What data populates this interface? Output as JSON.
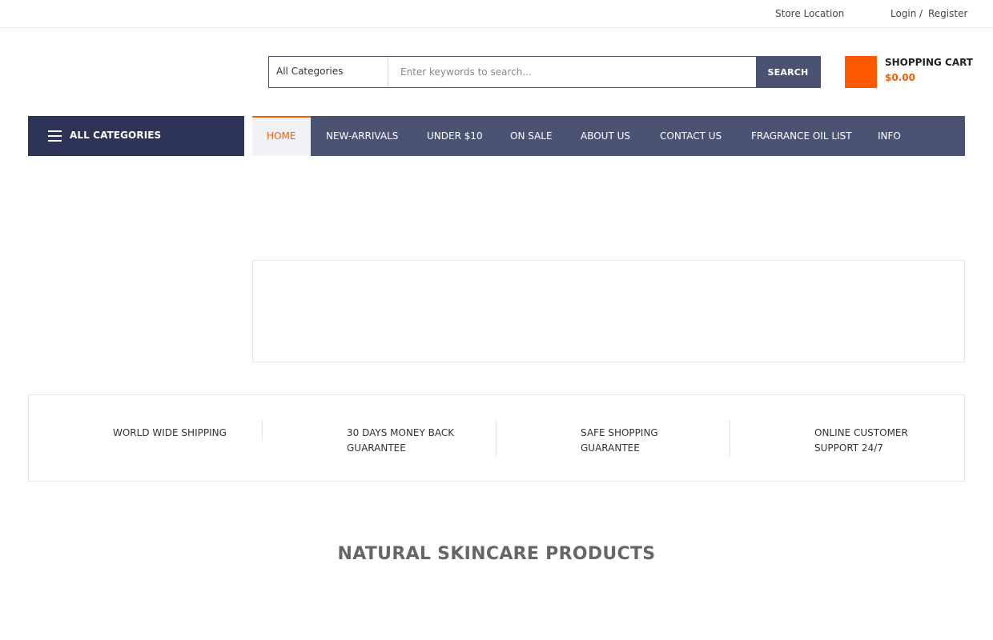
{
  "topbar": {
    "store_location": "Store Location",
    "login": "Login",
    "separator": "/",
    "register": "Register"
  },
  "search": {
    "category": "All Categories",
    "placeholder": "Enter keywords to search...",
    "button": "SEARCH"
  },
  "cart": {
    "label": "SHOPPING CART",
    "amount": "$0.00"
  },
  "nav": {
    "all_categories": "ALL CATEGORIES",
    "items": [
      {
        "label": "HOME"
      },
      {
        "label": "NEW-ARRIVALS"
      },
      {
        "label": "UNDER $10"
      },
      {
        "label": "ON SALE"
      },
      {
        "label": "ABOUT US"
      },
      {
        "label": "CONTACT US"
      },
      {
        "label": "FRAGRANCE OIL LIST"
      },
      {
        "label": "INFO"
      }
    ]
  },
  "features": [
    {
      "line1": "WORLD WIDE SHIPPING",
      "line2": ""
    },
    {
      "line1": "30 DAYS MONEY BACK",
      "line2": "GUARANTEE"
    },
    {
      "line1": "SAFE SHOPPING",
      "line2": "GUARANTEE"
    },
    {
      "line1": "ONLINE CUSTOMER",
      "line2": "SUPPORT 24/7"
    }
  ],
  "section_title": "NATURAL SKINCARE PRODUCTS",
  "colors": {
    "accent": "#ff5a00",
    "nav_bg": "#4a5372",
    "all_categories_bg": "#2c3558"
  }
}
